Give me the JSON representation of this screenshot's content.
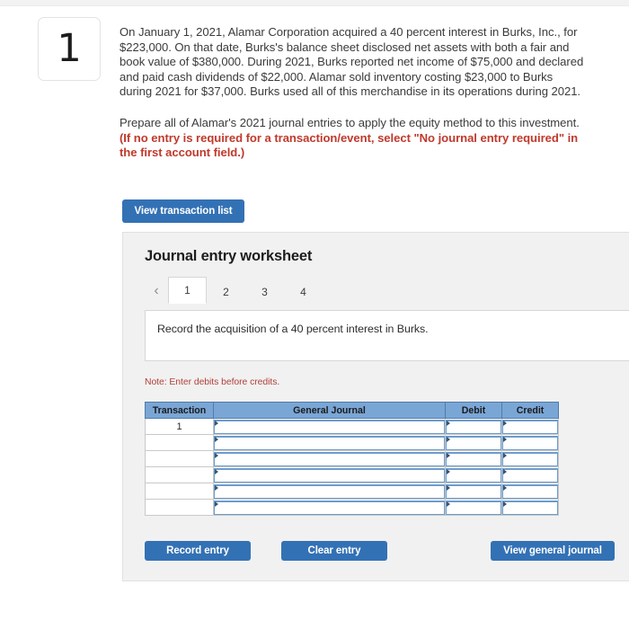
{
  "question": {
    "number": "1",
    "paragraph_1": "On January 1, 2021, Alamar Corporation acquired a 40 percent interest in Burks, Inc., for $223,000. On that date, Burks's balance sheet disclosed net assets with both a fair and book value of $380,000. During 2021, Burks reported net income of $75,000 and declared and paid cash dividends of $22,000. Alamar sold inventory costing $23,000 to Burks during 2021 for $37,000. Burks used all of this merchandise in its operations during 2021.",
    "paragraph_2_lead": "Prepare all of Alamar's 2021 journal entries to apply the equity method to this investment. ",
    "paragraph_2_red": "(If no entry is required for a transaction/event, select \"No journal entry required\" in the first account field.)"
  },
  "view_transaction_list_button": "View transaction list",
  "worksheet": {
    "title": "Journal entry worksheet",
    "prev_arrow": "‹",
    "tabs": [
      {
        "label": "1",
        "active": true
      },
      {
        "label": "2",
        "active": false
      },
      {
        "label": "3",
        "active": false
      },
      {
        "label": "4",
        "active": false
      }
    ],
    "instruction": "Record the acquisition of a 40 percent interest in Burks.",
    "note": "Note: Enter debits before credits.",
    "table": {
      "headers": [
        "Transaction",
        "General Journal",
        "Debit",
        "Credit"
      ],
      "rows": [
        {
          "transaction": "1",
          "general_journal": "",
          "debit": "",
          "credit": ""
        },
        {
          "transaction": "",
          "general_journal": "",
          "debit": "",
          "credit": ""
        },
        {
          "transaction": "",
          "general_journal": "",
          "debit": "",
          "credit": ""
        },
        {
          "transaction": "",
          "general_journal": "",
          "debit": "",
          "credit": ""
        },
        {
          "transaction": "",
          "general_journal": "",
          "debit": "",
          "credit": ""
        },
        {
          "transaction": "",
          "general_journal": "",
          "debit": "",
          "credit": ""
        }
      ]
    },
    "buttons": {
      "record_entry": "Record entry",
      "clear_entry": "Clear entry",
      "view_general_journal": "View general journal"
    }
  },
  "colors": {
    "accent_blue": "#3371b5",
    "table_header_blue": "#7aa6d6",
    "alert_red": "#c0392b",
    "note_red": "#b0413a",
    "panel_gray": "#f1f1f1"
  }
}
